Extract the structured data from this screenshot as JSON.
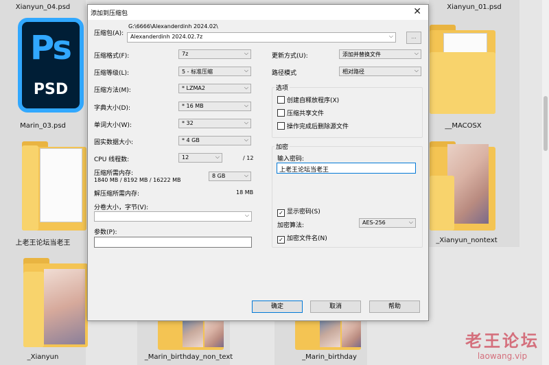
{
  "background_files": {
    "xianyun_04": "Xianyun_04.psd",
    "xianyun_01": "Xianyun_01.psd",
    "marin_03": "Marin_03.psd",
    "macosx": "__MACOSX",
    "laowang_folder": "上老王论坛当老王",
    "xianyun_nontext": "_Xianyun_nontext",
    "xianyun": "_Xianyun",
    "marin_birthday_non_text": "_Marin_birthday_non_text",
    "marin_birthday": "_Marin_birthday",
    "psd_icon_ps": "Ps",
    "psd_icon_ext": "PSD"
  },
  "watermark": {
    "line1": "老王论坛",
    "line2": "laowang.vip"
  },
  "dialog": {
    "title": "添加到压缩包",
    "close_glyph": "✕",
    "archive_label": "压缩包(A):",
    "archive_path": "G:\\6666\\Alexanderdinh 2024.02\\",
    "archive_name": "Alexanderdinh 2024.02.7z",
    "browse_label": "...",
    "format_label": "压缩格式(F):",
    "format_value": "7z",
    "level_label": "压缩等级(L):",
    "level_value": "5 - 标准压缩",
    "method_label": "压缩方法(M):",
    "method_value": "* LZMA2",
    "dict_label": "字典大小(D):",
    "dict_value": "* 16 MB",
    "word_label": "单词大小(W):",
    "word_value": "* 32",
    "solid_label": "固实数据大小:",
    "solid_value": "* 4 GB",
    "threads_label": "CPU 线程数:",
    "threads_value": "12",
    "threads_total": "/ 12",
    "mem_comp_label": "压缩所需内存:",
    "mem_comp_value": "1840 MB / 8192 MB / 16222 MB",
    "mem_limit_value": "8 GB",
    "mem_decomp_label": "解压缩所需内存:",
    "mem_decomp_value": "18 MB",
    "split_label": "分卷大小，字节(V):",
    "split_value": "",
    "params_label": "参数(P):",
    "params_value": "",
    "update_label": "更新方式(U):",
    "update_value": "添加并替换文件",
    "path_label": "路径模式",
    "path_value": "相对路径",
    "options_title": "选项",
    "opt_sfx": "创建自释放程序(X)",
    "opt_shared": "压缩共享文件",
    "opt_delete": "操作完成后删除源文件",
    "encryption_title": "加密",
    "password_label": "输入密码:",
    "password_value": "上老王论坛当老王",
    "show_password": "显示密码(S)",
    "enc_method_label": "加密算法:",
    "enc_method_value": "AES-256",
    "enc_filenames": "加密文件名(N)",
    "checkmark": "✓",
    "ok": "确定",
    "cancel": "取消",
    "help": "帮助"
  }
}
